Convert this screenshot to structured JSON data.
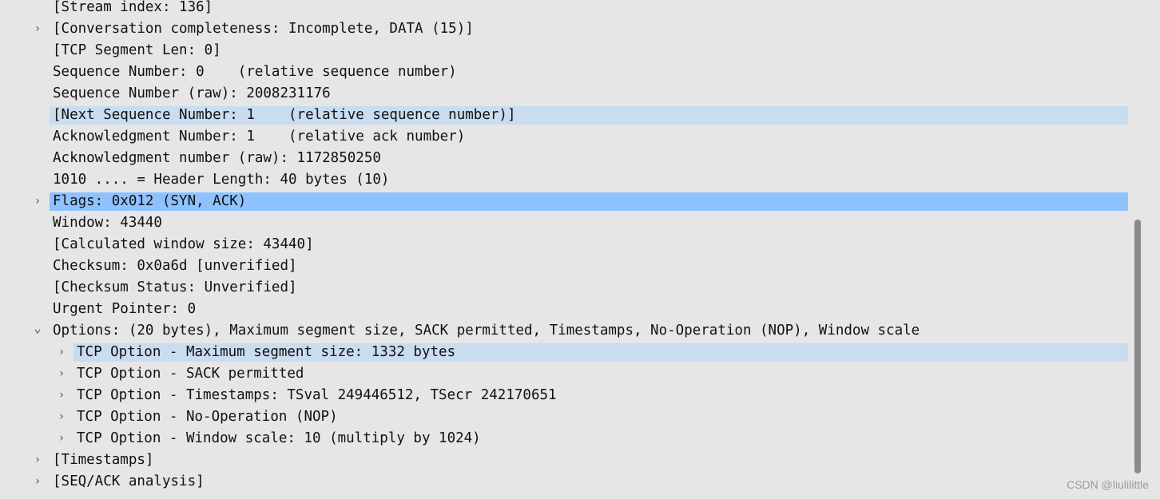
{
  "rows": [
    {
      "text": "[Stream index: 136]",
      "indent": 0,
      "arrow": "none",
      "highlight": "none"
    },
    {
      "text": "[Conversation completeness: Incomplete, DATA (15)]",
      "indent": 0,
      "arrow": "right",
      "highlight": "none"
    },
    {
      "text": "[TCP Segment Len: 0]",
      "indent": 0,
      "arrow": "none",
      "highlight": "none"
    },
    {
      "text": "Sequence Number: 0    (relative sequence number)",
      "indent": 0,
      "arrow": "none",
      "highlight": "none"
    },
    {
      "text": "Sequence Number (raw): 2008231176",
      "indent": 0,
      "arrow": "none",
      "highlight": "none"
    },
    {
      "text": "[Next Sequence Number: 1    (relative sequence number)]",
      "indent": 0,
      "arrow": "none",
      "highlight": "light"
    },
    {
      "text": "Acknowledgment Number: 1    (relative ack number)",
      "indent": 0,
      "arrow": "none",
      "highlight": "none"
    },
    {
      "text": "Acknowledgment number (raw): 1172850250",
      "indent": 0,
      "arrow": "none",
      "highlight": "none"
    },
    {
      "text": "1010 .... = Header Length: 40 bytes (10)",
      "indent": 0,
      "arrow": "none",
      "highlight": "none"
    },
    {
      "text": "Flags: 0x012 (SYN, ACK)",
      "indent": 0,
      "arrow": "right",
      "highlight": "strong"
    },
    {
      "text": "Window: 43440",
      "indent": 0,
      "arrow": "none",
      "highlight": "none"
    },
    {
      "text": "[Calculated window size: 43440]",
      "indent": 0,
      "arrow": "none",
      "highlight": "none"
    },
    {
      "text": "Checksum: 0x0a6d [unverified]",
      "indent": 0,
      "arrow": "none",
      "highlight": "none"
    },
    {
      "text": "[Checksum Status: Unverified]",
      "indent": 0,
      "arrow": "none",
      "highlight": "none"
    },
    {
      "text": "Urgent Pointer: 0",
      "indent": 0,
      "arrow": "none",
      "highlight": "none"
    },
    {
      "text": "Options: (20 bytes), Maximum segment size, SACK permitted, Timestamps, No-Operation (NOP), Window scale",
      "indent": 0,
      "arrow": "down",
      "highlight": "none"
    },
    {
      "text": "TCP Option - Maximum segment size: 1332 bytes",
      "indent": 1,
      "arrow": "right",
      "highlight": "light"
    },
    {
      "text": "TCP Option - SACK permitted",
      "indent": 1,
      "arrow": "right",
      "highlight": "none"
    },
    {
      "text": "TCP Option - Timestamps: TSval 249446512, TSecr 242170651",
      "indent": 1,
      "arrow": "right",
      "highlight": "none"
    },
    {
      "text": "TCP Option - No-Operation (NOP)",
      "indent": 1,
      "arrow": "right",
      "highlight": "none"
    },
    {
      "text": "TCP Option - Window scale: 10 (multiply by 1024)",
      "indent": 1,
      "arrow": "right",
      "highlight": "none"
    },
    {
      "text": "[Timestamps]",
      "indent": 0,
      "arrow": "right",
      "highlight": "none"
    },
    {
      "text": "[SEQ/ACK analysis]",
      "indent": 0,
      "arrow": "right",
      "highlight": "none"
    }
  ],
  "watermark": "CSDN @liulilittle"
}
